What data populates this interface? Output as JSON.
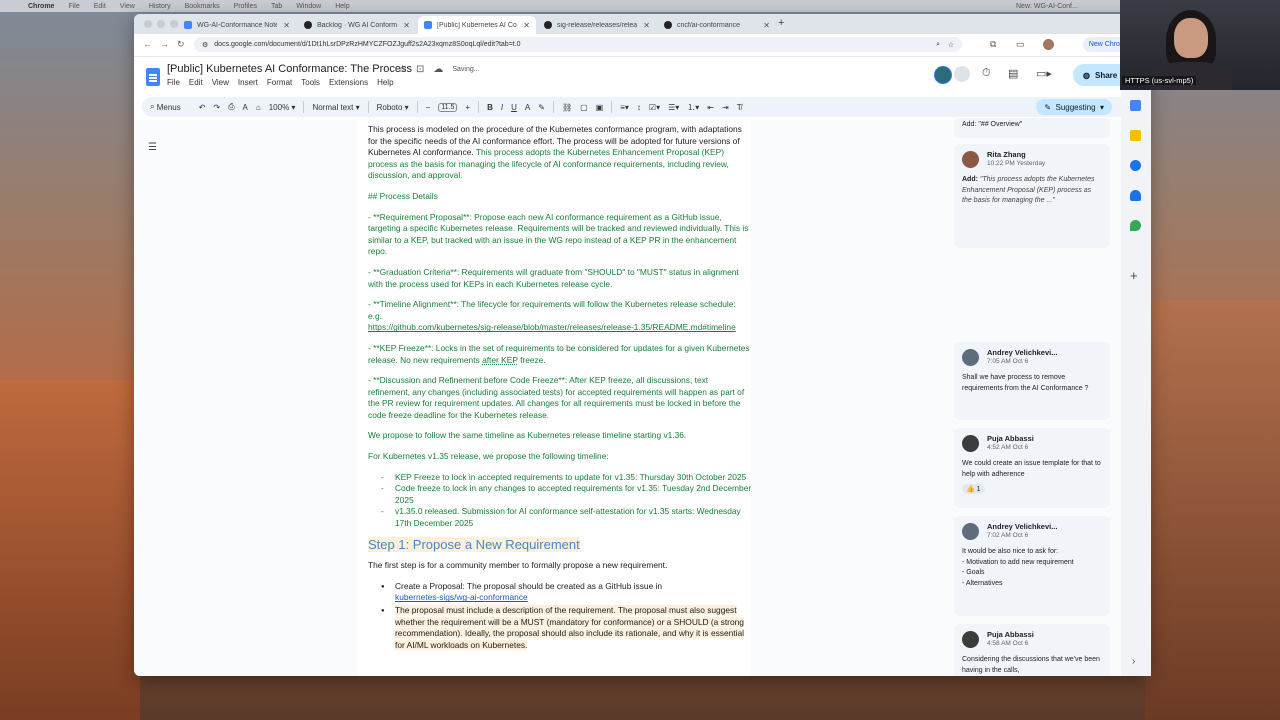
{
  "mac_menubar": {
    "app": "Chrome",
    "items": [
      "File",
      "Edit",
      "View",
      "History",
      "Bookmarks",
      "Profiles",
      "Tab",
      "Window",
      "Help"
    ],
    "right_text": "New: WG-AI-Conf..."
  },
  "tabs": [
    {
      "label": "WG-AI-Conformance Notes",
      "icon": "google-docs-icon",
      "active": false
    },
    {
      "label": "Backlog · WG AI Conformanc",
      "icon": "github-icon",
      "active": false
    },
    {
      "label": "[Public] Kubernetes AI Confo",
      "icon": "google-docs-icon",
      "active": true
    },
    {
      "label": "sig-release/releases/release-",
      "icon": "github-icon",
      "active": false
    },
    {
      "label": "cncf/ai-conformance",
      "icon": "github-icon",
      "active": false
    }
  ],
  "address": {
    "url": "docs.google.com/document/d/1Dt1hLsrDPzRzHMYCZFOZJguff2s2A23xqmz8S0oqLql/edit?tab=t.0",
    "new_chrome": "New Chrome avail"
  },
  "doc": {
    "title": "[Public] Kubernetes AI Conformance: The Process",
    "status": "Saving...",
    "menus": [
      "File",
      "Edit",
      "View",
      "Insert",
      "Format",
      "Tools",
      "Extensions",
      "Help"
    ],
    "share": "Share"
  },
  "toolbar": {
    "menus": "Menus",
    "zoom": "100%",
    "style": "Normal text",
    "font": "Roboto",
    "size": "11.5",
    "mode": "Suggesting"
  },
  "content": {
    "p1_black": "This process is modeled on the procedure of the Kubernetes conformance program, with adaptations for the specific needs of the AI conformance effort. The process will be adopted for future versions of Kubernetes AI conformance.",
    "p1_green": "This process adopts the Kubernetes Enhancement Proposal (KEP) process as the basis for managing the lifecycle of AI conformance requirements, including review, discussion, and approval.",
    "h_process": "## Process Details",
    "p_req": "- **Requirement Proposal**: Propose each new AI conformance requirement as a GitHub issue, targeting a specific Kubernetes release. Requirements will be tracked and reviewed individually. This is similar to a KEP, but tracked with an issue in the WG repo instead of a KEP PR in the enhancement repo.",
    "p_grad": "- **Graduation Criteria**: Requirements will graduate from \"SHOULD\" to \"MUST\" status in alignment with the process used for KEPs in each Kubernetes release cycle.",
    "p_time": "- **Timeline Alignment**: The lifecycle for requirements will follow the Kubernetes release schedule: e.g.",
    "p_time_link": "https://github.com/kubernetes/sig-release/blob/master/releases/release-1.35/README.md#timeline",
    "p_kep_a": "  - **KEP Freeze**: Locks in the set of requirements to be considered for updates for a given Kubernetes release. No new requirements ",
    "p_kep_u": "after KEP",
    "p_kep_b": " freeze.",
    "p_disc": "  - **Discussion and Refinement before Code Freeze**: After KEP freeze, all discussions, text refinement, any changes (including associated tests) for accepted requirements will happen as part of the PR review for requirement updates. All changes for all requirements must be locked in before the code freeze deadline for the Kubernetes release.",
    "p_follow": "We propose to follow the same timeline as Kubernetes release timeline starting v1.36.",
    "p_v135": "For Kubernetes v1.35 release, we propose the following timeline:",
    "timeline": [
      "KEP Freeze to lock in accepted requirements to update for v1.35: Thursday 30th October 2025",
      "Code freeze to lock in any changes to accepted requirements for v1.35: Tuesday 2nd December 2025",
      "v1.35.0 released. Submission for AI conformance self-attestation for v1.35 starts: Wednesday 17th December 2025"
    ],
    "step1": "Step 1: Propose a New Requirement",
    "p_first": "The first step is for a community member to formally propose a new requirement.",
    "b1_text": "Create a Proposal: The proposal should be created as a GitHub issue in",
    "b1_link": "kubernetes-sigs/wg-ai-conformance",
    "b2_text": "The proposal must include a description of the requirement. The proposal must also suggest whether the requirement will be a MUST (mandatory for conformance) or a SHOULD (a strong recommendation). Ideally, the proposal should also include its rationale, and why it is essential for AI/ML workloads on Kubernetes."
  },
  "comments": [
    {
      "type": "partial",
      "text": "Add: \"## Overview\""
    },
    {
      "author": "Rita Zhang",
      "time": "10:22 PM Yesterday",
      "add_label": "Add:",
      "text": "\"This process adopts the Kubernetes Enhancement Proposal (KEP) process as the basis for managing the ...\"",
      "avatar_color": "#8a5a44"
    },
    {
      "author": "Andrey Velichkevi...",
      "time": "7:05 AM Oct 6",
      "text": "Shall we have process to remove requirements from the AI Conformance  ?",
      "avatar_color": "#5d6d7e"
    },
    {
      "author": "Puja Abbassi",
      "time": "4:52 AM Oct 6",
      "text": "We could create an issue template for that to help with adherence",
      "reaction": "👍 1",
      "avatar_color": "#3c3c3c"
    },
    {
      "author": "Andrey Velichkevi...",
      "time": "7:02 AM Oct 6",
      "text_lines": [
        "It would be also nice to ask for:",
        "- Motivation to add new requirement",
        "- Goals",
        "- Alternatives"
      ],
      "avatar_color": "#5d6d7e"
    },
    {
      "author": "Puja Abbassi",
      "time": "4:58 AM Oct 6",
      "text": "Considering the discussions that we've been having in the calls,",
      "avatar_color": "#3c3c3c"
    }
  ],
  "video": {
    "label": "HTTPS (us-svl-mp5)"
  }
}
